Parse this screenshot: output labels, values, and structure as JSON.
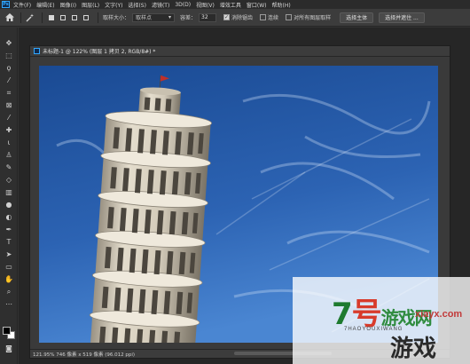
{
  "app": {
    "logo": "Ps"
  },
  "menu": [
    "文件(F)",
    "编辑(E)",
    "图像(I)",
    "图层(L)",
    "文字(Y)",
    "选择(S)",
    "滤镜(T)",
    "3D(D)",
    "视图(V)",
    "增效工具",
    "窗口(W)",
    "帮助(H)"
  ],
  "options": {
    "sample_size_label": "取样大小：",
    "sample_size_value": "取样点",
    "tolerance_label": "容差：",
    "tolerance_value": "32",
    "anti_alias_label": "消除锯齿",
    "anti_alias_checked": true,
    "contiguous_label": "连续",
    "contiguous_checked": false,
    "sample_all_layers_label": "对所有图层取样",
    "sample_all_layers_checked": false,
    "select_subject_button": "选择主体",
    "select_and_mask_button": "选择并遮住 ..."
  },
  "document": {
    "title": "未标题-1 @ 122% (图层 1 拷贝 2, RGB/8#) *",
    "status": "121.95%  746 像素 x 519 像素 (96.012 ppi)"
  },
  "watermark": {
    "site": "xiayx.com",
    "big_digit": "7",
    "big_char": "号",
    "big_rest": "游戏网",
    "pinyin": "7HAOYOUXIWANG",
    "cn": "游戏"
  },
  "colors": {
    "sky_top": "#1d4f9a",
    "sky_bottom": "#3a78c9",
    "tower_stone": "#d9d2c3",
    "tower_shadow": "#8f887a",
    "accent": "#31a8ff"
  },
  "icons": {
    "toolbar": [
      "move-icon",
      "marquee-icon",
      "lasso-icon",
      "magic-wand-icon",
      "crop-icon",
      "frame-icon",
      "eyedropper-icon",
      "healing-brush-icon",
      "brush-icon",
      "clone-stamp-icon",
      "history-brush-icon",
      "eraser-icon",
      "gradient-icon",
      "blur-icon",
      "dodge-icon",
      "pen-icon",
      "type-icon",
      "path-selection-icon",
      "rectangle-icon",
      "hand-icon",
      "zoom-icon",
      "more-tools-icon"
    ]
  }
}
